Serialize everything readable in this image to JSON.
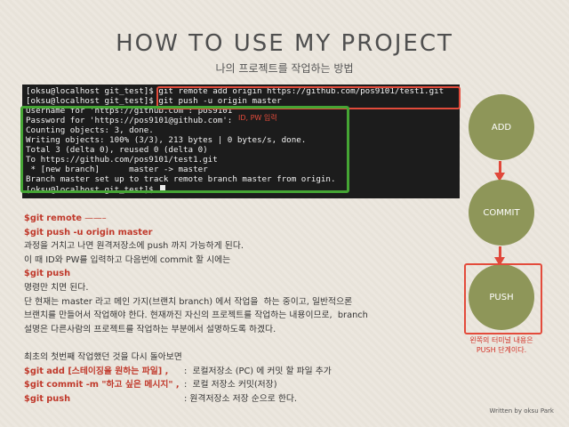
{
  "title": "HOW TO USE MY PROJECT",
  "subtitle": "나의 프로젝트를 작업하는 방법",
  "terminal": {
    "lines": [
      "[oksu@localhost git_test]$ git remote add origin https://github.com/pos9101/test1.git",
      "[oksu@localhost git_test]$ git push -u origin master",
      "Username for 'https://github.com': pos9101",
      "Password for 'https://pos9101@github.com':",
      "Counting objects: 3, done.",
      "Writing objects: 100% (3/3), 213 bytes | 0 bytes/s, done.",
      "Total 3 (delta 0), reused 0 (delta 0)",
      "To https://github.com/pos9101/test1.git",
      " * [new branch]      master -> master",
      "Branch master set up to track remote branch master from origin.",
      "[oksu@localhost git_test]$ "
    ],
    "annotation": "ID, PW 입력"
  },
  "flow": {
    "steps": [
      "ADD",
      "COMMIT",
      "PUSH"
    ],
    "note_line1": "왼쪽의 터미널 내용은",
    "note_line2": "PUSH 단계이다.",
    "accent_color": "#8e9659",
    "highlight_color": "#e34b3b"
  },
  "body": {
    "l1_cmd": "$git remote",
    "l1_rest": " ——–",
    "l2_cmd": "$git push -u origin master",
    "l3": "과정을 거치고 나면 원격저장소에 push 까지 가능하게 된다.",
    "l4": "이 때 ID와 PW를 입력하고 다음번에 commit 할 시에는",
    "l5_cmd": "$git push",
    "l6": "명령만 치면 된다.",
    "l7": "단 현재는 master 라고 메인 가지(브랜치 branch) 에서 작업을  하는 중이고, 일반적으론",
    "l8": "브랜치를 만들어서 작업해야 한다. 현재까진 자신의 프로젝트를 작업하는 내용이므로,  branch",
    "l9": "설명은 다른사람의 프로젝트를 작업하는 부분에서 설명하도록 하겠다.",
    "l10": "최초의 첫번째 작업했던 것을 다시 돌아보면",
    "r1_cmd": "$git add [스테이징을 원하는 파일] ,",
    "r1_desc": ":  로컬저장소 (PC) 에 커밋 할 파일 추가",
    "r2_cmd": "$git commit -m \"하고 싶은 메시지\" ,",
    "r2_desc": ":  로컬 저장소 커밋(저장)",
    "r3_cmd": "$git push",
    "r3_desc": ": 원격저장소 저장 순으로 한다."
  },
  "footer": "Written by oksu Park"
}
